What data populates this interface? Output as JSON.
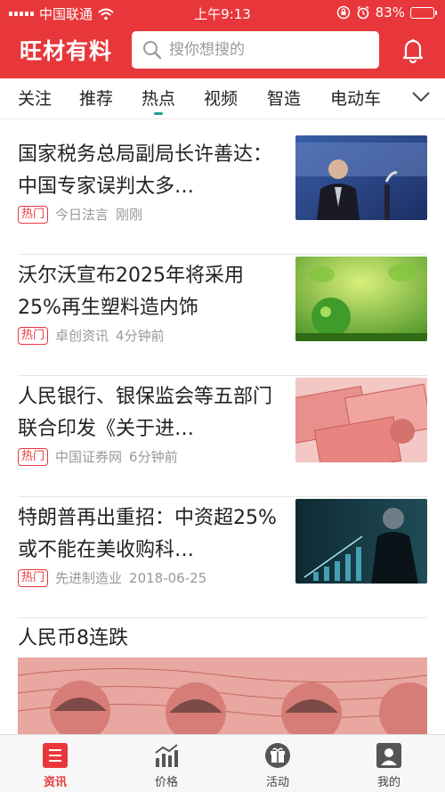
{
  "status_bar": {
    "carrier": "中国联通",
    "time": "上午9:13",
    "battery": "83%",
    "battery_level": 0.83
  },
  "header": {
    "logo": "旺材有料",
    "search_placeholder": "搜你想搜的"
  },
  "tabs": [
    {
      "label": "关注"
    },
    {
      "label": "推荐"
    },
    {
      "label": "热点",
      "active": true
    },
    {
      "label": "视频"
    },
    {
      "label": "智造"
    },
    {
      "label": "电动车"
    }
  ],
  "feed": [
    {
      "title": "国家税务总局副局长许善达：中国专家误判太多…",
      "badge": "热门",
      "source": "今日法言",
      "time": "刚刚"
    },
    {
      "title": "沃尔沃宣布2025年将采用25%再生塑料造内饰",
      "badge": "热门",
      "source": "卓创资讯",
      "time": "4分钟前"
    },
    {
      "title": "人民银行、银保监会等五部门联合印发《关于进…",
      "badge": "热门",
      "source": "中国证券网",
      "time": "6分钟前"
    },
    {
      "title": "特朗普再出重招：中资超25%或不能在美收购科…",
      "badge": "热门",
      "source": "先进制造业",
      "time": "2018-06-25"
    },
    {
      "title": "人民币8连跌"
    }
  ],
  "bottom_nav": [
    {
      "label": "资讯",
      "icon": "news-icon",
      "active": true
    },
    {
      "label": "价格",
      "icon": "chart-icon"
    },
    {
      "label": "活动",
      "icon": "gift-icon"
    },
    {
      "label": "我的",
      "icon": "user-icon"
    }
  ],
  "colors": {
    "brand": "#e8373b",
    "tab_indicator": "#1aa38c"
  }
}
